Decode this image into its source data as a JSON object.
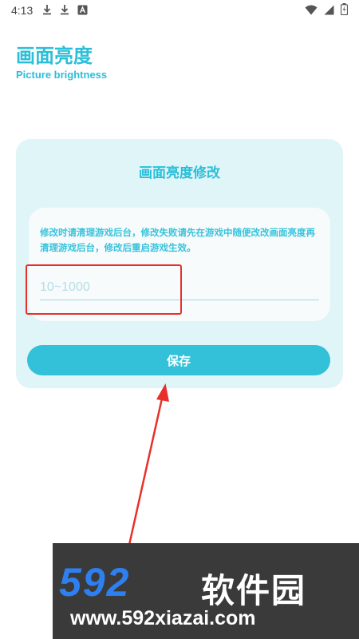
{
  "status_bar": {
    "time": "4:13",
    "left_icons": [
      "download-icon",
      "download-icon",
      "accessibility-icon"
    ],
    "right_icons": [
      "wifi-icon",
      "signal-icon",
      "battery-icon"
    ]
  },
  "header": {
    "title": "画面亮度",
    "subtitle": "Picture brightness"
  },
  "card": {
    "title": "画面亮度修改",
    "hint": "修改时请清理游戏后台，修改失败请先在游戏中随便改改画面亮度再清理游戏后台，修改后重启游戏生效。",
    "input": {
      "value": "",
      "placeholder": "10~1000"
    },
    "save_label": "保存"
  },
  "annotation": {
    "highlight_color": "#e8302a",
    "arrow_color": "#e8302a"
  },
  "watermark": {
    "logo_number": "592",
    "logo_text": "软件园",
    "url": "www.592xiazai.com"
  },
  "colors": {
    "accent": "#2bbfd9",
    "card_bg": "#dff5f8",
    "button_bg": "#32c1d9"
  }
}
